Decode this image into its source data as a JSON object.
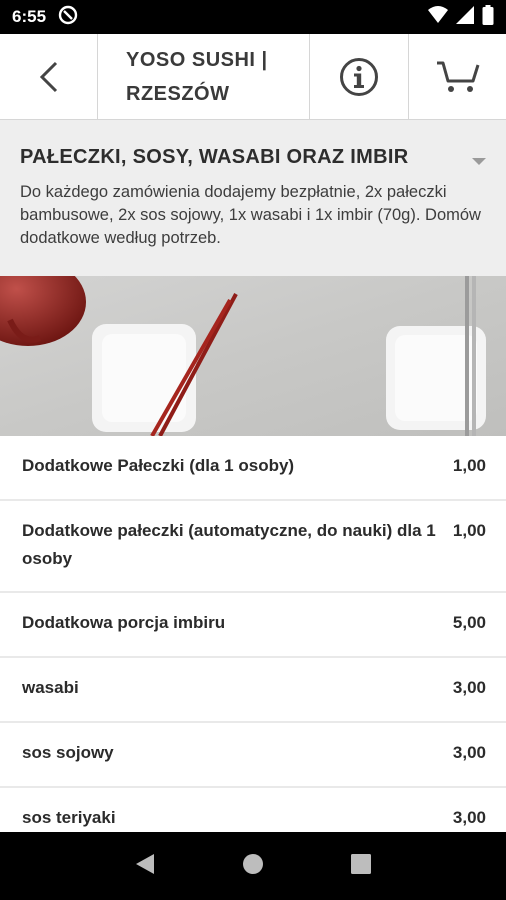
{
  "status_bar": {
    "time": "6:55"
  },
  "app_bar": {
    "title": "YOSO SUSHI |\nRZESZÓW"
  },
  "category": {
    "title": "PAŁECZKI, SOSY, WASABI ORAZ IMBIR",
    "description": "Do każdego zamówienia dodajemy bezpłatnie, 2x pałeczki bambusowe, 2x sos sojowy, 1x wasabi i 1x imbir (70g). Domów dodatkowe według potrzeb."
  },
  "products": [
    {
      "name": "Dodatkowe Pałeczki (dla 1 osoby)",
      "price": "1,00"
    },
    {
      "name": "Dodatkowe pałeczki (automatyczne, do nauki) dla 1 osoby",
      "price": "1,00"
    },
    {
      "name": "Dodatkowa porcja imbiru",
      "price": "5,00"
    },
    {
      "name": "wasabi",
      "price": "3,00"
    },
    {
      "name": "sos sojowy",
      "price": "3,00"
    },
    {
      "name": "sos teriyaki",
      "price": "3,00"
    }
  ]
}
